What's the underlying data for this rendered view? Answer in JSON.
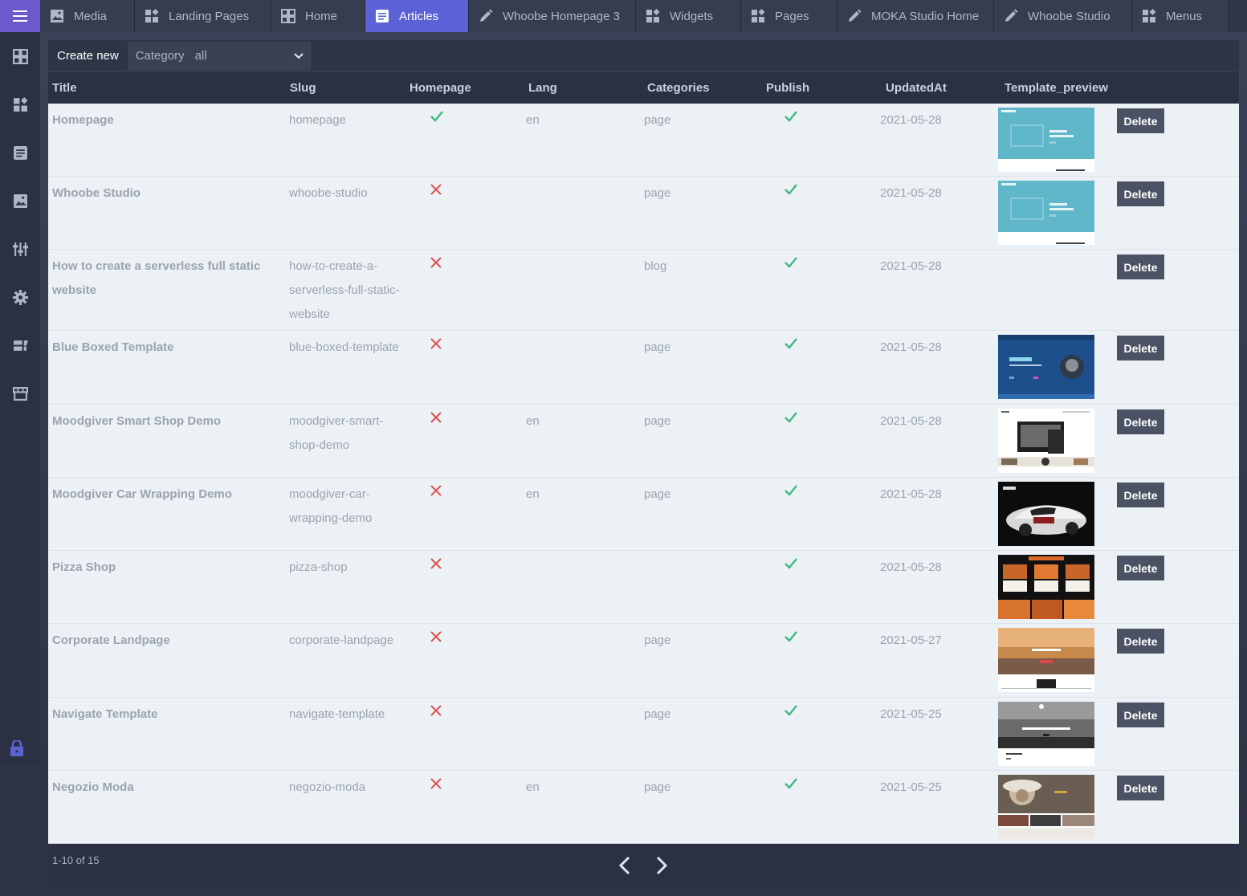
{
  "tabs": [
    {
      "label": "Media",
      "icon": "image-icon",
      "active": false
    },
    {
      "label": "Landing Pages",
      "icon": "widgets-icon",
      "active": false
    },
    {
      "label": "Home",
      "icon": "grid-icon",
      "active": false
    },
    {
      "label": "Articles",
      "icon": "article-icon",
      "active": true
    },
    {
      "label": "Whoobe Homepage 3",
      "icon": "pencil-icon",
      "active": false
    },
    {
      "label": "Widgets",
      "icon": "widgets-icon",
      "active": false
    },
    {
      "label": "Pages",
      "icon": "widgets-icon",
      "active": false
    },
    {
      "label": "MOKA Studio Home",
      "icon": "pencil-icon",
      "active": false
    },
    {
      "label": "Whoobe Studio",
      "icon": "pencil-icon",
      "active": false
    },
    {
      "label": "Menus",
      "icon": "widgets-icon",
      "active": false
    }
  ],
  "sidebar": {
    "items": [
      "grid-icon",
      "widgets-icon",
      "article-icon",
      "image-icon",
      "sliders-icon",
      "gear-icon",
      "template-icon",
      "store-icon"
    ],
    "lock_icon": "lock-icon"
  },
  "toolbar": {
    "create_label": "Create new",
    "category_label": "Category",
    "category_value": "all"
  },
  "table": {
    "headers": {
      "title": "Title",
      "slug": "Slug",
      "homepage": "Homepage",
      "lang": "Lang",
      "categories": "Categories",
      "publish": "Publish",
      "updated": "UpdatedAt",
      "preview": "Template_preview"
    },
    "delete_label": "Delete",
    "rows": [
      {
        "title": "Homepage",
        "slug": "homepage",
        "homepage": true,
        "lang": "en",
        "category": "page",
        "publish": true,
        "updated": "2021-05-28",
        "preview": "teal"
      },
      {
        "title": "Whoobe Studio",
        "slug": "whoobe-studio",
        "homepage": false,
        "lang": "",
        "category": "page",
        "publish": true,
        "updated": "2021-05-28",
        "preview": "teal"
      },
      {
        "title": "How to create a serverless full static website",
        "slug": "how-to-create-a-serverless-full-static-website",
        "homepage": false,
        "lang": "",
        "category": "blog",
        "publish": true,
        "updated": "2021-05-28",
        "preview": "none"
      },
      {
        "title": "Blue Boxed Template",
        "slug": "blue-boxed-template",
        "homepage": false,
        "lang": "",
        "category": "page",
        "publish": true,
        "updated": "2021-05-28",
        "preview": "blue"
      },
      {
        "title": "Moodgiver Smart Shop Demo",
        "slug": "moodgiver-smart-shop-demo",
        "homepage": false,
        "lang": "en",
        "category": "page",
        "publish": true,
        "updated": "2021-05-28",
        "preview": "shop"
      },
      {
        "title": "Moodgiver Car Wrapping Demo",
        "slug": "moodgiver-car-wrapping-demo",
        "homepage": false,
        "lang": "en",
        "category": "page",
        "publish": true,
        "updated": "2021-05-28",
        "preview": "car"
      },
      {
        "title": "Pizza Shop",
        "slug": "pizza-shop",
        "homepage": false,
        "lang": "",
        "category": "",
        "publish": true,
        "updated": "2021-05-28",
        "preview": "pizza"
      },
      {
        "title": "Corporate Landpage",
        "slug": "corporate-landpage",
        "homepage": false,
        "lang": "",
        "category": "page",
        "publish": true,
        "updated": "2021-05-27",
        "preview": "sunset"
      },
      {
        "title": "Navigate Template",
        "slug": "navigate-template",
        "homepage": false,
        "lang": "",
        "category": "page",
        "publish": true,
        "updated": "2021-05-25",
        "preview": "gray"
      },
      {
        "title": "Negozio Moda",
        "slug": "negozio-moda",
        "homepage": false,
        "lang": "en",
        "category": "page",
        "publish": true,
        "updated": "2021-05-25",
        "preview": "fashion"
      }
    ]
  },
  "footer": {
    "count": "1-10 of 15"
  },
  "colors": {
    "accent": "#5b62d6",
    "check": "#3fb87f",
    "cross": "#d9534f"
  }
}
